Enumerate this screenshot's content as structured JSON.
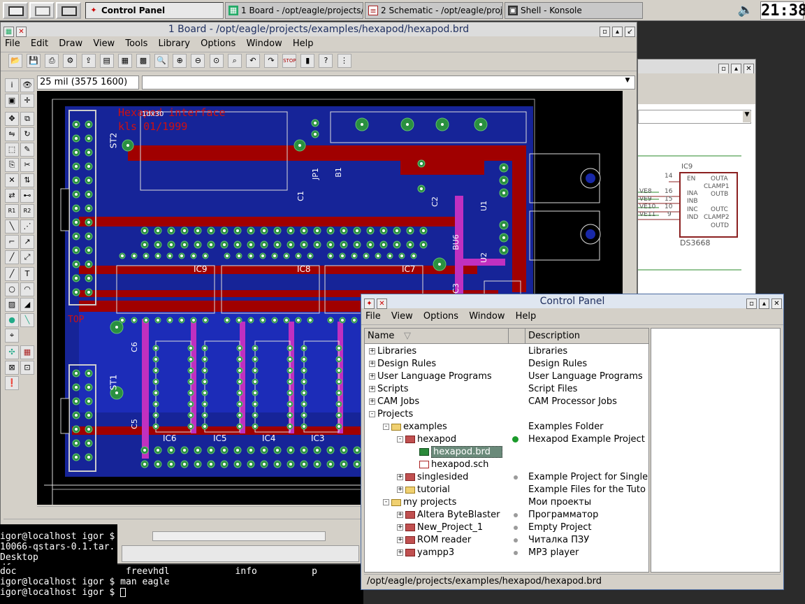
{
  "taskbar": {
    "tasks": [
      {
        "label": "Control Panel",
        "icon": "eagle-icon"
      },
      {
        "label": "1 Board - /opt/eagle/projects/",
        "icon": "board-icon"
      },
      {
        "label": "2 Schematic - /opt/eagle/proj",
        "icon": "schematic-icon"
      },
      {
        "label": "Shell - Konsole",
        "icon": "konsole-icon"
      }
    ],
    "clock": "21:38"
  },
  "board": {
    "title": "1 Board - /opt/eagle/projects/examples/hexapod/hexapod.brd",
    "menu": [
      "File",
      "Edit",
      "Draw",
      "View",
      "Tools",
      "Library",
      "Options",
      "Window",
      "Help"
    ],
    "coord_readout": "25 mil (3575 1600)",
    "board_text": [
      "Hexapod interface",
      "kls 01/1999",
      "TOP"
    ],
    "parts": [
      "ST2",
      "ST1",
      "IC9",
      "IC8",
      "IC7",
      "IC6",
      "IC5",
      "IC4",
      "IC3",
      "JP1",
      "B1",
      "C1",
      "C2",
      "C3",
      "C5",
      "C6",
      "U1",
      "U2",
      "BU6",
      "1dx30"
    ]
  },
  "schematic": {
    "part": "IC9",
    "pins_left": [
      "EN",
      "INA",
      "INB",
      "INC",
      "IND"
    ],
    "pins_right": [
      "OUTA",
      "CLAMP1",
      "OUTB",
      "OUTC",
      "CLAMP2",
      "OUTD"
    ],
    "nets": [
      "VE8",
      "VE9",
      "VE10",
      "VE11"
    ],
    "pin_numbers": [
      "14",
      "16",
      "15",
      "10",
      "9"
    ],
    "part_value": "DS3668"
  },
  "konsole": {
    "lines": [
      "igor@localhost igor $ ",
      "10066-qstars-0.1.tar.",
      "Desktop",
      "df",
      "doc                    freevhdl            info          p",
      "igor@localhost igor $ man eagle",
      "igor@localhost igor $ "
    ]
  },
  "control_panel": {
    "title": "Control Panel",
    "menu": [
      "File",
      "View",
      "Options",
      "Window",
      "Help"
    ],
    "columns": {
      "name": "Name",
      "description": "Description"
    },
    "status": "/opt/eagle/projects/examples/hexapod/hexapod.brd",
    "rows": [
      {
        "name": "Libraries",
        "desc": "Libraries",
        "level": 0,
        "exp": "+",
        "icon": "none"
      },
      {
        "name": "Design Rules",
        "desc": "Design Rules",
        "level": 0,
        "exp": "+",
        "icon": "none"
      },
      {
        "name": "User Language Programs",
        "desc": "User Language Programs",
        "level": 0,
        "exp": "+",
        "icon": "none"
      },
      {
        "name": "Scripts",
        "desc": "Script Files",
        "level": 0,
        "exp": "+",
        "icon": "none"
      },
      {
        "name": "CAM Jobs",
        "desc": "CAM Processor Jobs",
        "level": 0,
        "exp": "+",
        "icon": "none"
      },
      {
        "name": "Projects",
        "desc": "",
        "level": 0,
        "exp": "-",
        "icon": "none"
      },
      {
        "name": "examples",
        "desc": "Examples Folder",
        "level": 1,
        "exp": "-",
        "icon": "folder"
      },
      {
        "name": "hexapod",
        "desc": "Hexapod Example Project",
        "level": 2,
        "exp": "-",
        "icon": "proj",
        "dot": "green"
      },
      {
        "name": "hexapod.brd",
        "desc": "",
        "level": 3,
        "exp": "",
        "icon": "brd",
        "selected": true
      },
      {
        "name": "hexapod.sch",
        "desc": "",
        "level": 3,
        "exp": "",
        "icon": "sch"
      },
      {
        "name": "singlesided",
        "desc": "Example Project for Single",
        "level": 2,
        "exp": "+",
        "icon": "proj",
        "dot": "grey"
      },
      {
        "name": "tutorial",
        "desc": "Example Files for the Tuto",
        "level": 2,
        "exp": "+",
        "icon": "folder"
      },
      {
        "name": "my projects",
        "desc": "Мои проекты",
        "level": 1,
        "exp": "-",
        "icon": "folder"
      },
      {
        "name": "Altera ByteBlaster",
        "desc": "Программатор",
        "level": 2,
        "exp": "+",
        "icon": "proj",
        "dot": "grey"
      },
      {
        "name": "New_Project_1",
        "desc": "Empty Project",
        "level": 2,
        "exp": "+",
        "icon": "proj",
        "dot": "grey"
      },
      {
        "name": "ROM reader",
        "desc": "Читалка ПЗУ",
        "level": 2,
        "exp": "+",
        "icon": "proj",
        "dot": "grey"
      },
      {
        "name": "yampp3",
        "desc": "MP3 player",
        "level": 2,
        "exp": "+",
        "icon": "proj",
        "dot": "grey"
      }
    ]
  },
  "colors": {
    "pcb_bg": "#000000",
    "top_layer": "#b00000",
    "bottom_layer": "#2030c0",
    "pad": "#2a9040",
    "via": "#c020c0"
  }
}
